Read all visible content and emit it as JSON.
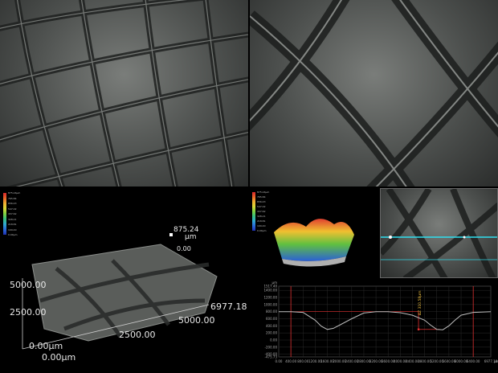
{
  "view3d": {
    "axis_y_mid": "5000.00",
    "axis_y_low": "2500.00",
    "origin_y": "0.00μm",
    "origin_x": "0.00μm",
    "axis_x_mid": "2500.00",
    "axis_x_far": "5000.00",
    "axis_x_max": "6977.18",
    "z_value": "875.24",
    "z_unit": "μm",
    "z_zero": "0.00"
  },
  "legend": {
    "labels": [
      "875.24μm",
      "765.84",
      "656.43",
      "547.02",
      "437.62",
      "328.21",
      "218.81",
      "109.40",
      "0.00μm"
    ],
    "colors": [
      "#d8262a",
      "#e8642a",
      "#f0b030",
      "#d8d838",
      "#7cd040",
      "#38c080",
      "#30a8d0",
      "#2a6ad8",
      "#2030b0"
    ]
  },
  "profile": {
    "y_ticks": [
      "1517.40",
      "1400.00",
      "1200.00",
      "1000.00",
      "800.00",
      "600.00",
      "400.00",
      "200.00",
      "0.00",
      "-200.00",
      "-400.00",
      "-475.73"
    ],
    "x_ticks": [
      "0.00",
      "400.00",
      "800.00",
      "1200.00",
      "1600.00",
      "2000.00",
      "2400.00",
      "2800.00",
      "3200.00",
      "3600.00",
      "4000.00",
      "4400.00",
      "4800.00",
      "5200.00",
      "5600.00",
      "6000.00",
      "6400.00",
      "6977.18"
    ],
    "y_unit": "μm",
    "x_unit": "μm",
    "measure_label": "ΔZ 310.58μm",
    "curve": [
      [
        0,
        800
      ],
      [
        400,
        800
      ],
      [
        800,
        780
      ],
      [
        1200,
        560
      ],
      [
        1400,
        390
      ],
      [
        1600,
        300
      ],
      [
        1800,
        330
      ],
      [
        2000,
        420
      ],
      [
        2400,
        600
      ],
      [
        2800,
        760
      ],
      [
        3200,
        800
      ],
      [
        3600,
        800
      ],
      [
        4000,
        770
      ],
      [
        4400,
        700
      ],
      [
        4800,
        560
      ],
      [
        5000,
        420
      ],
      [
        5200,
        300
      ],
      [
        5400,
        290
      ],
      [
        5600,
        400
      ],
      [
        5800,
        560
      ],
      [
        6000,
        700
      ],
      [
        6400,
        780
      ],
      [
        6977.18,
        800
      ]
    ],
    "x_range": [
      0,
      6977.18
    ],
    "y_range": [
      -475.73,
      1517.4
    ]
  }
}
